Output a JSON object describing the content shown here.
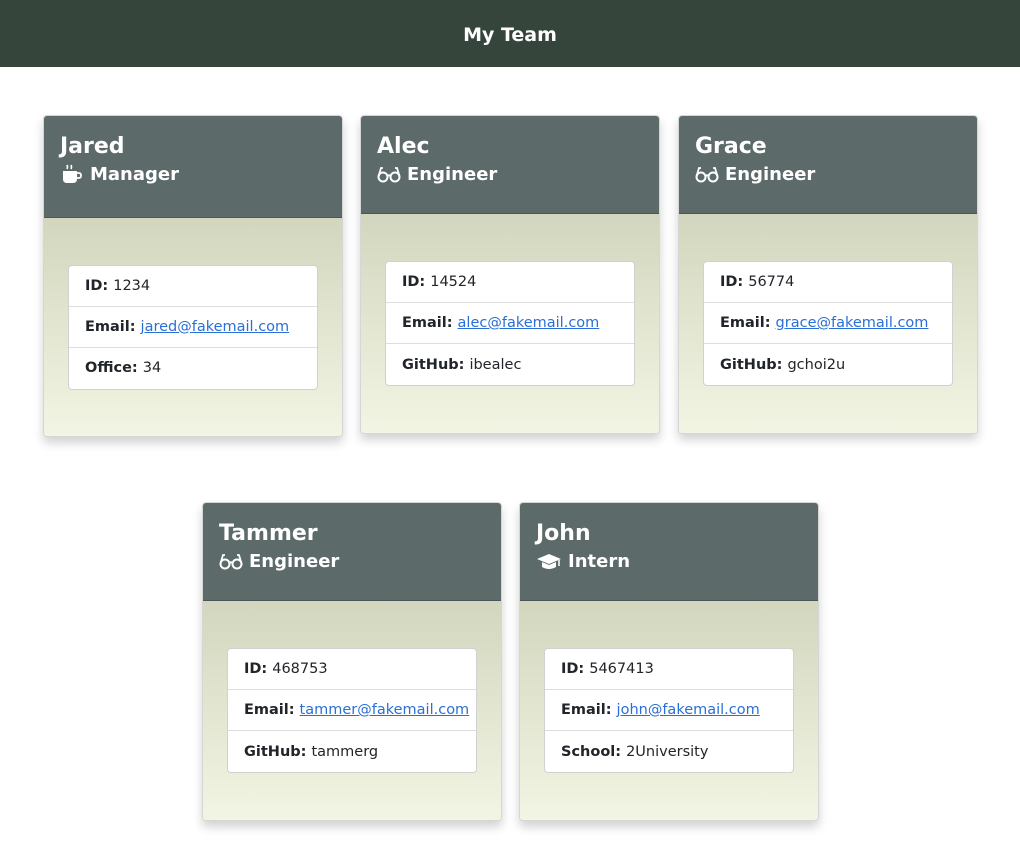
{
  "header": {
    "title": "My Team"
  },
  "employees": [
    {
      "name": "Jared",
      "role": "Manager",
      "icon": "coffee-icon",
      "fields": [
        {
          "label": "ID:",
          "value": "1234"
        },
        {
          "label": "Email:",
          "value": "jared@fakemail.com"
        },
        {
          "label": "Office:",
          "value": "34"
        }
      ]
    },
    {
      "name": "Alec",
      "role": "Engineer",
      "icon": "glasses-icon",
      "fields": [
        {
          "label": "ID:",
          "value": "14524"
        },
        {
          "label": "Email:",
          "value": "alec@fakemail.com"
        },
        {
          "label": "GitHub:",
          "value": "ibealec"
        }
      ]
    },
    {
      "name": "Grace",
      "role": "Engineer",
      "icon": "glasses-icon",
      "fields": [
        {
          "label": "ID:",
          "value": "56774"
        },
        {
          "label": "Email:",
          "value": "grace@fakemail.com"
        },
        {
          "label": "GitHub:",
          "value": "gchoi2u"
        }
      ]
    },
    {
      "name": "Tammer",
      "role": "Engineer",
      "icon": "glasses-icon",
      "fields": [
        {
          "label": "ID:",
          "value": "468753"
        },
        {
          "label": "Email:",
          "value": "tammer@fakemail.com"
        },
        {
          "label": "GitHub:",
          "value": "tammerg"
        }
      ]
    },
    {
      "name": "John",
      "role": "Intern",
      "icon": "graduation-cap-icon",
      "fields": [
        {
          "label": "ID:",
          "value": "5467413"
        },
        {
          "label": "Email:",
          "value": "john@fakemail.com"
        },
        {
          "label": "School:",
          "value": "2University"
        }
      ]
    }
  ],
  "colors": {
    "navbar": "#36453b",
    "card_header": "#5c6a69",
    "card_body_top": "#d3d6be",
    "card_body_bottom": "#f2f5e3",
    "link": "#2a6fd6"
  }
}
